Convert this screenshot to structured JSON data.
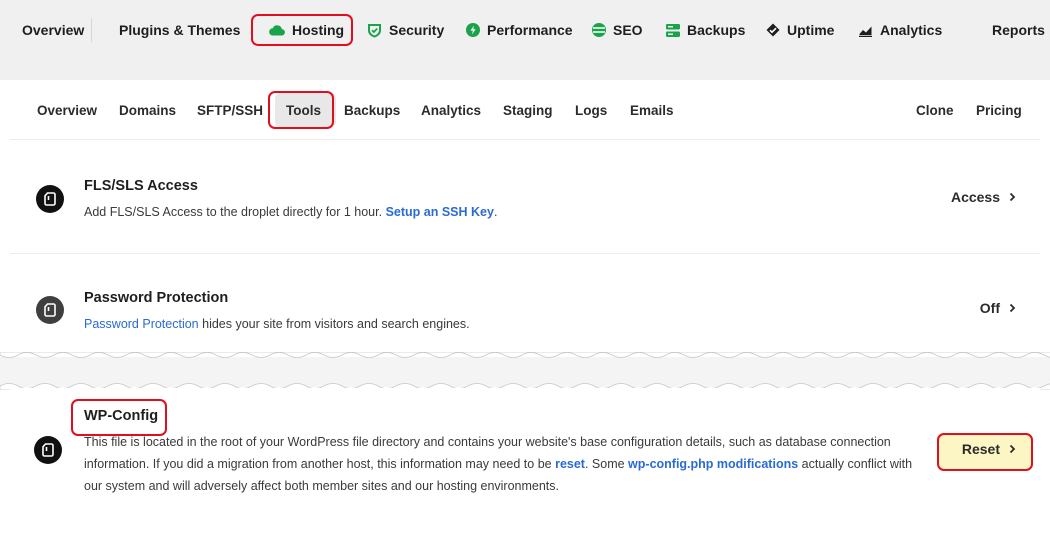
{
  "top_nav": {
    "items": [
      {
        "label": "Overview",
        "icon": ""
      },
      {
        "label": "Plugins & Themes",
        "icon": ""
      },
      {
        "label": "Hosting",
        "icon": "cloud-icon",
        "color": "#1aa34a"
      },
      {
        "label": "Security",
        "icon": "shield-icon",
        "color": "#1aa34a"
      },
      {
        "label": "Performance",
        "icon": "bolt-icon",
        "color": "#1aa34a"
      },
      {
        "label": "SEO",
        "icon": "globe-icon",
        "color": "#1aa34a"
      },
      {
        "label": "Backups",
        "icon": "backups-icon",
        "color": "#1aa34a"
      },
      {
        "label": "Uptime",
        "icon": "uptime-icon",
        "color": "#1e1e1e"
      },
      {
        "label": "Analytics",
        "icon": "chart-icon",
        "color": "#1e1e1e"
      },
      {
        "label": "Reports",
        "icon": ""
      }
    ],
    "active": "Hosting"
  },
  "sub_nav": {
    "items": [
      "Overview",
      "Domains",
      "SFTP/SSH",
      "Tools",
      "Backups",
      "Analytics",
      "Staging",
      "Logs",
      "Emails"
    ],
    "right_items": [
      "Clone",
      "Pricing"
    ],
    "active": "Tools"
  },
  "tools": [
    {
      "title": "FLS/SLS Access",
      "desc_text": "Add FLS/SLS Access to the droplet directly for 1 hour. ",
      "desc_link": "Setup an SSH Key",
      "desc_after": ".",
      "action": "Access",
      "icon": "file-icon"
    },
    {
      "title": "Password Protection",
      "desc_link": "Password Protection",
      "desc_text": " hides your site from visitors and search engines.",
      "action": "Off",
      "icon": "file-icon"
    },
    {
      "title": "WP-Config",
      "desc_part1": "This file is located in the root of your WordPress file directory and contains your website's base configuration details, such as database connection information. If you did a migration from another host, this information may need to be ",
      "desc_link1": "reset",
      "desc_part2": ". Some ",
      "desc_link2": "wp-config.php modifications",
      "desc_part3": " actually conflict with our system and will adversely affect both member sites and our hosting environments.",
      "action": "Reset",
      "icon": "file-icon"
    }
  ],
  "colors": {
    "accent_green": "#1aa34a",
    "link_blue": "#2a6bd3",
    "highlight_red": "#e10e1f",
    "reset_highlight": "#fbf6c4"
  }
}
